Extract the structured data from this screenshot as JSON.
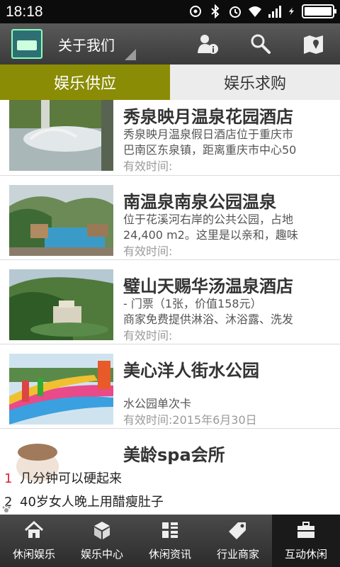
{
  "status_bar": {
    "time": "18:18"
  },
  "header": {
    "title": "关于我们"
  },
  "tabs": [
    {
      "label": "娱乐供应",
      "active": true
    },
    {
      "label": "娱乐求购",
      "active": false
    }
  ],
  "items": [
    {
      "title": "秀泉映月温泉花园酒店",
      "desc_lines": [
        "秀泉映月温泉假日酒店位于重庆市",
        "巴南区东泉镇，距离重庆市中心50"
      ],
      "valid": "有效时间:"
    },
    {
      "title": "南温泉南泉公园温泉",
      "desc_lines": [
        "位于花溪河右岸的公共公园，占地",
        "24,400 m2。这里是以亲和，趣味"
      ],
      "valid": "有效时间:"
    },
    {
      "title": "璧山天赐华汤温泉酒店",
      "desc_lines": [
        "- 门票（1张，价值158元）",
        " 商家免费提供淋浴、沐浴露、洗发"
      ],
      "valid": "有效时间:"
    },
    {
      "title": "美心洋人街水公园",
      "desc_lines": [
        "水公园单次卡"
      ],
      "valid": "有效时间:2015年6月30日"
    },
    {
      "title": "美龄spa会所",
      "desc_lines": [],
      "valid": ""
    }
  ],
  "hot_list": [
    {
      "num": "1",
      "text": "几分钟可以硬起来"
    },
    {
      "num": "2",
      "text": "40岁女人晚上用醋瘦肚子"
    }
  ],
  "bottom_nav": [
    {
      "label": "休闲娱乐",
      "icon": "home-icon"
    },
    {
      "label": "娱乐中心",
      "icon": "cube-icon"
    },
    {
      "label": "休闲资讯",
      "icon": "grid-icon"
    },
    {
      "label": "行业商家",
      "icon": "tag-icon"
    },
    {
      "label": "互动休闲",
      "icon": "briefcase-icon",
      "active": true
    }
  ],
  "colors": {
    "tab_active": "#8b8c05",
    "hot_first_num": "#dd2233"
  }
}
